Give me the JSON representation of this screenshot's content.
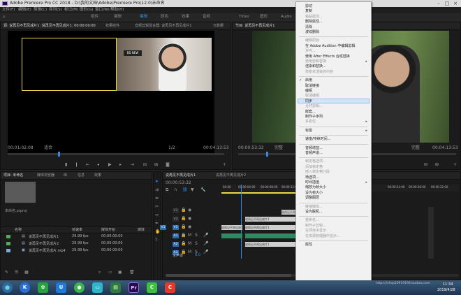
{
  "window": {
    "title": "Adobe Premiere Pro CC 2018 - D:\\我的文档\\Adobe\\Premiere Pro\\12.0\\未命名"
  },
  "menu": [
    "文件(F)",
    "编辑(E)",
    "剪辑(C)",
    "序列(S)",
    "标记(M)",
    "图形(G)",
    "窗口(W)",
    "帮助(H)"
  ],
  "workspace": [
    "组件",
    "编辑",
    "颜色",
    "效果",
    "音频",
    "图形",
    "库",
    "Titles",
    "图形",
    "Audio"
  ],
  "source_panel": {
    "tabs": [
      "源: 说再见不再见成片1: 说再见不再见成片1: 00:00:00:00",
      "效果控件",
      "音频剪辑混合器: 说再见不再见成片1",
      "元数据"
    ],
    "timecode_left": "00:01:02:08",
    "fit": "适合",
    "scale": "1/2",
    "timecode_right": "00:04:13:53"
  },
  "program_panel": {
    "tab": "节目: 说再见不再见成片1",
    "timecode_left": "00:00:53:32",
    "fit": "完整",
    "timecode_right": "00:04:13:53"
  },
  "project_panel": {
    "tabs": [
      "项目: 未命名",
      "媒体浏览器",
      "库",
      "信息",
      "效果"
    ],
    "file": "未命名.prproj",
    "columns": [
      "名称",
      "帧速率",
      "媒体开始",
      "媒体"
    ],
    "rows": [
      {
        "color": "#4caf50",
        "name": "说再见不再见成片1",
        "fps": "29.99 fps",
        "start": "00:00:00:00"
      },
      {
        "color": "#4caf50",
        "name": "说再见不再见成片2",
        "fps": "29.99 fps",
        "start": "00:00:00:00"
      },
      {
        "color": "#7fa8d8",
        "name": "说再见不再见成片.mp4",
        "fps": "29.99 fps",
        "start": "00:00:00:00"
      }
    ]
  },
  "timeline_panel": {
    "tabs": [
      "说再见不再见成片1",
      "说再见不再见成片2"
    ],
    "timecode": "00:00:53:32",
    "ruler": [
      "00:00",
      "00:00:04:00",
      "00:00:08:00",
      "00:00:12:00",
      "00:00:16:00",
      "00:00:20:00",
      "00:00:24:00",
      "00:00:28:00",
      "00:00:32:00"
    ],
    "tracks": [
      "V3",
      "V2",
      "V1",
      "A1",
      "A2",
      "A3"
    ],
    "master": "主声道",
    "master_value": "0.0",
    "clip_label": "说再见不再见成片1"
  },
  "context_menu": [
    {
      "label": "剪切",
      "state": "enabled"
    },
    {
      "label": "复制",
      "state": "enabled"
    },
    {
      "label": "粘贴属性...",
      "state": "disabled"
    },
    {
      "label": "删除属性...",
      "state": "enabled"
    },
    {
      "label": "清除",
      "state": "enabled"
    },
    {
      "label": "波纹删除",
      "state": "enabled"
    },
    {
      "sep": true
    },
    {
      "label": "编辑原始",
      "state": "disabled"
    },
    {
      "label": "在 Adobe Audition 中编辑剪辑",
      "state": "enabled"
    },
    {
      "label": "许可...",
      "state": "disabled"
    },
    {
      "label": "使用 After Effects 合成替换",
      "state": "enabled"
    },
    {
      "label": "使用剪辑替换",
      "state": "disabled",
      "submenu": true
    },
    {
      "label": "渲染和替换...",
      "state": "enabled"
    },
    {
      "label": "恢复未渲染的内容",
      "state": "disabled"
    },
    {
      "sep": true
    },
    {
      "label": "启用",
      "state": "enabled",
      "checked": true
    },
    {
      "label": "取消链接",
      "state": "enabled"
    },
    {
      "label": "编组",
      "state": "enabled"
    },
    {
      "label": "取消编组",
      "state": "disabled"
    },
    {
      "label": "同步",
      "state": "enabled",
      "highlighted": true
    },
    {
      "label": "合并剪辑...",
      "state": "disabled"
    },
    {
      "label": "嵌套...",
      "state": "enabled"
    },
    {
      "label": "制作子序列",
      "state": "enabled"
    },
    {
      "label": "多机位",
      "state": "disabled",
      "submenu": true
    },
    {
      "sep": true
    },
    {
      "label": "标签",
      "state": "enabled",
      "submenu": true
    },
    {
      "sep": true
    },
    {
      "label": "速度/持续时间...",
      "state": "enabled"
    },
    {
      "sep": true
    },
    {
      "label": "音频增益...",
      "state": "enabled"
    },
    {
      "label": "音频声道...",
      "state": "enabled"
    },
    {
      "sep": true
    },
    {
      "label": "帧定格选项...",
      "state": "disabled"
    },
    {
      "label": "添加帧定格",
      "state": "disabled"
    },
    {
      "label": "插入帧定格分段",
      "state": "disabled"
    },
    {
      "label": "场选项...",
      "state": "enabled"
    },
    {
      "label": "时间插值",
      "state": "enabled",
      "submenu": true
    },
    {
      "label": "缩放为帧大小",
      "state": "enabled"
    },
    {
      "label": "设为帧大小",
      "state": "enabled"
    },
    {
      "label": "调整图层",
      "state": "enabled"
    },
    {
      "sep": true
    },
    {
      "label": "链接媒体...",
      "state": "disabled"
    },
    {
      "label": "设为脱机...",
      "state": "enabled"
    },
    {
      "sep": true
    },
    {
      "label": "重命名...",
      "state": "disabled"
    },
    {
      "label": "制作子剪辑...",
      "state": "disabled"
    },
    {
      "label": "在项目中显示",
      "state": "disabled"
    },
    {
      "label": "在资源管理器中显示...",
      "state": "disabled"
    },
    {
      "sep": true
    },
    {
      "label": "属性",
      "state": "enabled"
    }
  ],
  "taskbar": {
    "time": "11:34",
    "date": "2019/4/28",
    "watermark": "https://shop10919194.taobao.com"
  },
  "colors": {
    "accent": "#2d8ceb",
    "yellow_box": "#e8d84a"
  }
}
